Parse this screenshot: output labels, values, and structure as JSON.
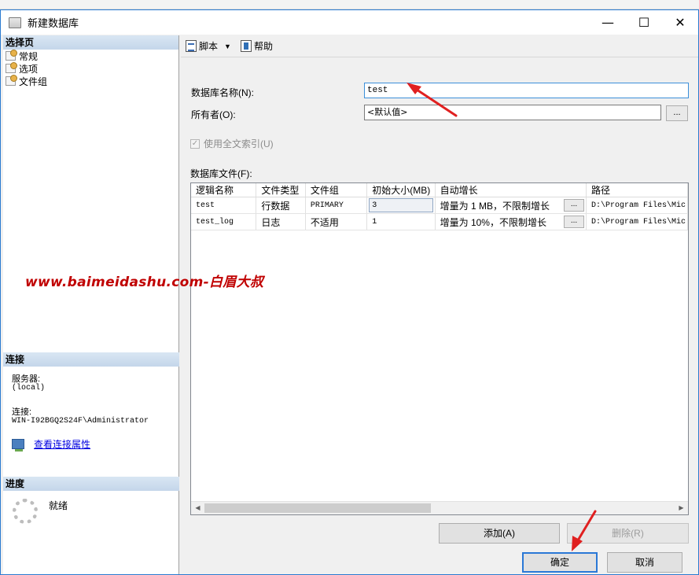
{
  "window": {
    "title": "新建数据库",
    "minimize": "—",
    "maximize": "☐",
    "close": "✕"
  },
  "left": {
    "select_page_header": "选择页",
    "pages": [
      {
        "label": "常规"
      },
      {
        "label": "选项"
      },
      {
        "label": "文件组"
      }
    ],
    "connection_header": "连接",
    "server_label": "服务器:",
    "server_value": "(local)",
    "connection_label": "连接:",
    "connection_value": "WIN-I92BGQ2S24F\\Administrator",
    "view_conn_props": "查看连接属性",
    "progress_header": "进度",
    "progress_status": "就绪"
  },
  "toolbar": {
    "script_label": "脚本",
    "script_caret": "▼",
    "help_label": "帮助"
  },
  "form": {
    "db_name_label": "数据库名称(N):",
    "db_name_value": "test",
    "owner_label": "所有者(O):",
    "owner_value": "<默认值>",
    "owner_browse": "...",
    "fulltext_label": "使用全文索引(U)",
    "fulltext_check": "✓",
    "files_label": "数据库文件(F):"
  },
  "grid": {
    "columns": [
      "逻辑名称",
      "文件类型",
      "文件组",
      "初始大小(MB)",
      "自动增长",
      "路径"
    ],
    "rows": [
      {
        "logical": "test",
        "type": "行数据",
        "filegroup": "PRIMARY",
        "size": "3",
        "growth": "增量为 1 MB，不限制增长",
        "growth_btn": "...",
        "path": "D:\\Program Files\\Mic"
      },
      {
        "logical": "test_log",
        "type": "日志",
        "filegroup": "不适用",
        "size": "1",
        "growth": "增量为 10%，不限制增长",
        "growth_btn": "...",
        "path": "D:\\Program Files\\Mic"
      }
    ],
    "scroll_left": "◀",
    "scroll_right": "▶"
  },
  "buttons": {
    "add": "添加(A)",
    "remove": "删除(R)",
    "ok": "确定",
    "cancel": "取消"
  },
  "watermark": "www.baimeidashu.com-白眉大叔",
  "colors": {
    "accent": "#2a78d6",
    "annotation": "#e02020",
    "watermark": "#c00000"
  }
}
